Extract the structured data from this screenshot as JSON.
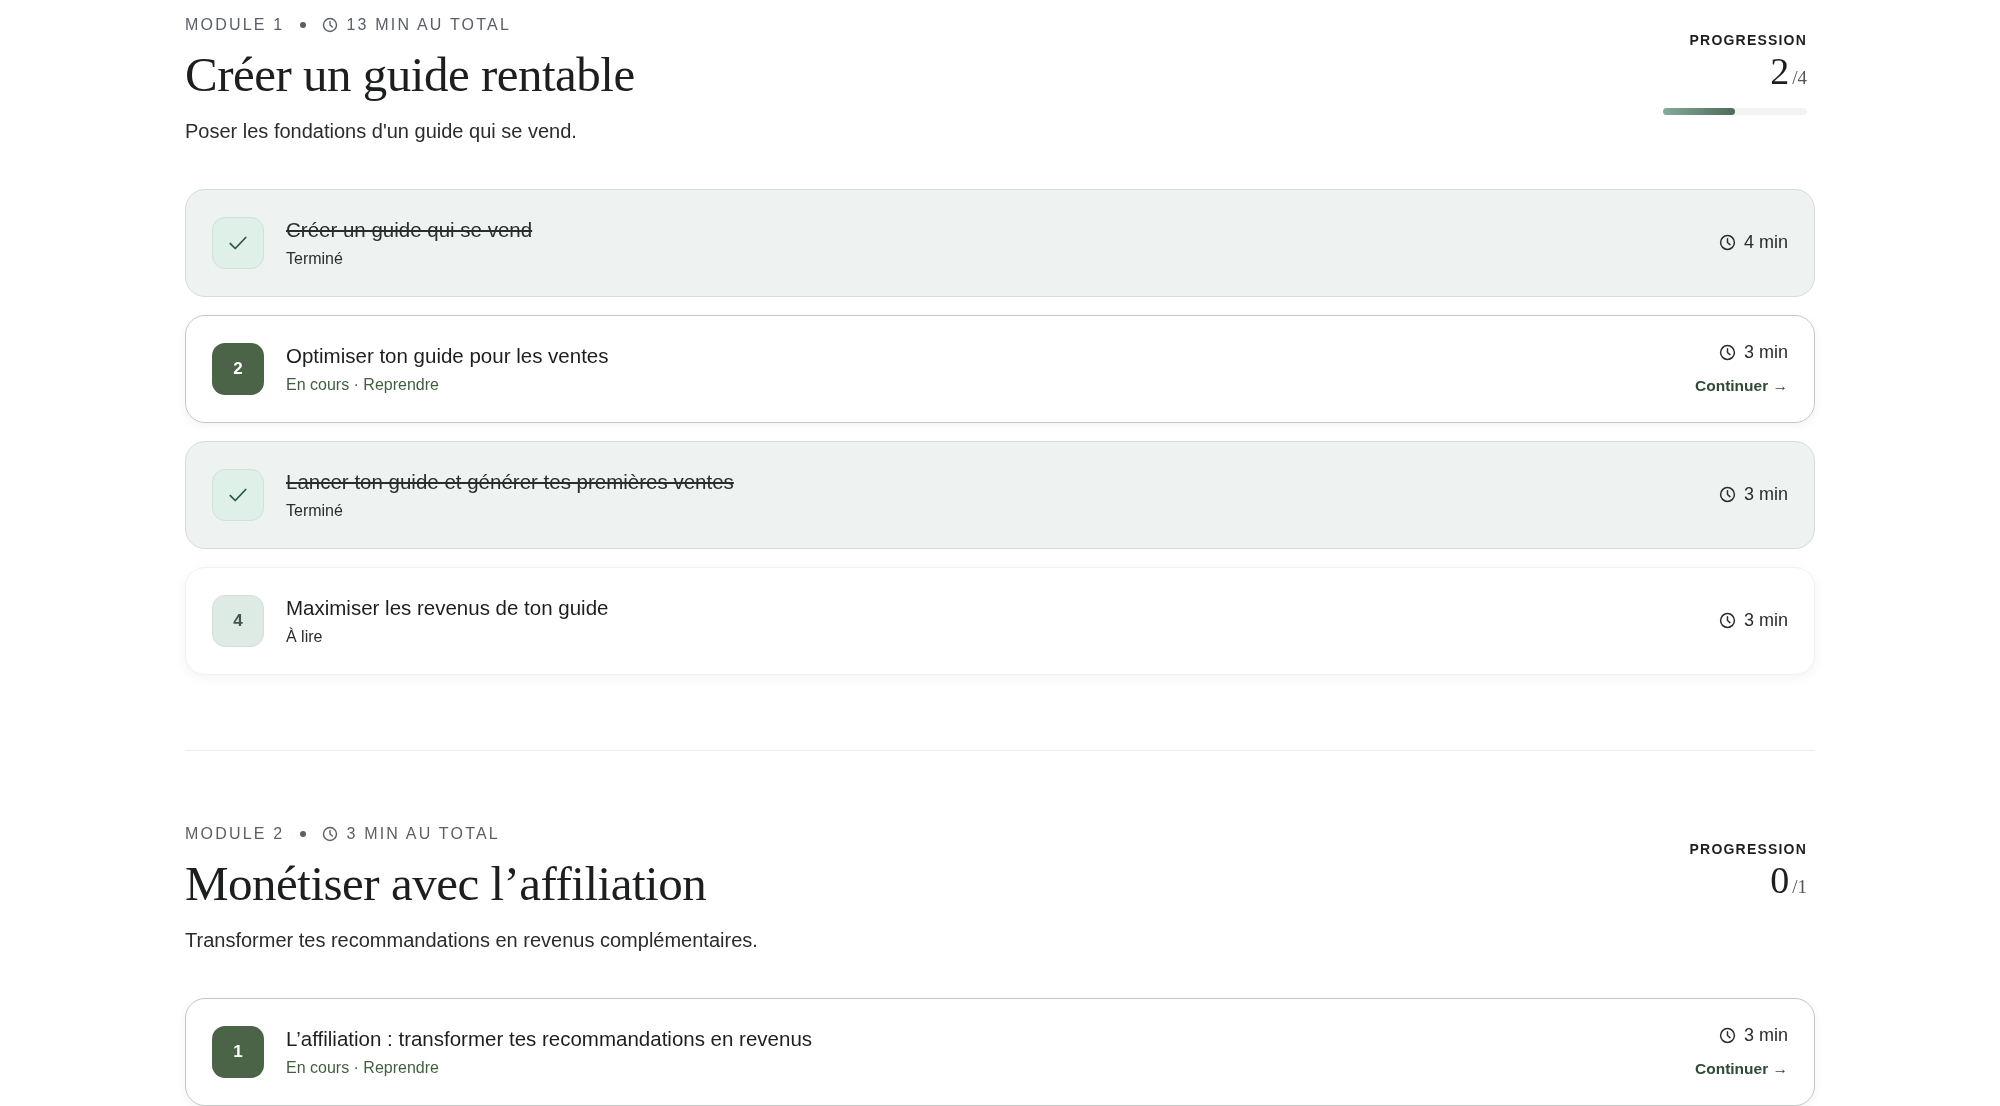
{
  "modules": [
    {
      "label": "MODULE 1",
      "duration": "13 MIN AU TOTAL",
      "title": "Créer un guide rentable",
      "subtitle": "Poser les fondations d'un guide qui se vend.",
      "progress": {
        "label": "PROGRESSION",
        "done": "2",
        "total": "/4",
        "level": 0.5
      },
      "lessons": [
        {
          "kind": "done",
          "title": "Créer un guide qui se vend",
          "status": "Terminé",
          "time": "4 min"
        },
        {
          "kind": "current",
          "badge": "2",
          "title": "Optimiser ton guide pour les ventes",
          "status": "En cours · Reprendre",
          "time": "3 min",
          "action": "Continuer →"
        },
        {
          "kind": "done",
          "title": "Lancer ton guide et générer tes premières ventes",
          "status": "Terminé",
          "time": "3 min"
        },
        {
          "kind": "todo",
          "badge": "4",
          "title": "Maximiser les revenus de ton guide",
          "status": "À lire",
          "time": "3 min"
        }
      ]
    },
    {
      "label": "MODULE 2",
      "duration": "3 MIN AU TOTAL",
      "title": "Monétiser avec l’affiliation",
      "subtitle": "Transformer tes recommandations en revenus complémentaires.",
      "progress": {
        "label": "PROGRESSION",
        "done": "0",
        "total": "/1"
      },
      "lessons": [
        {
          "kind": "current",
          "badge": "1",
          "title": "L’affiliation : transformer tes recommandations en revenus",
          "status": "En cours · Reprendre",
          "time": "3 min",
          "action": "Continuer →"
        }
      ]
    }
  ]
}
